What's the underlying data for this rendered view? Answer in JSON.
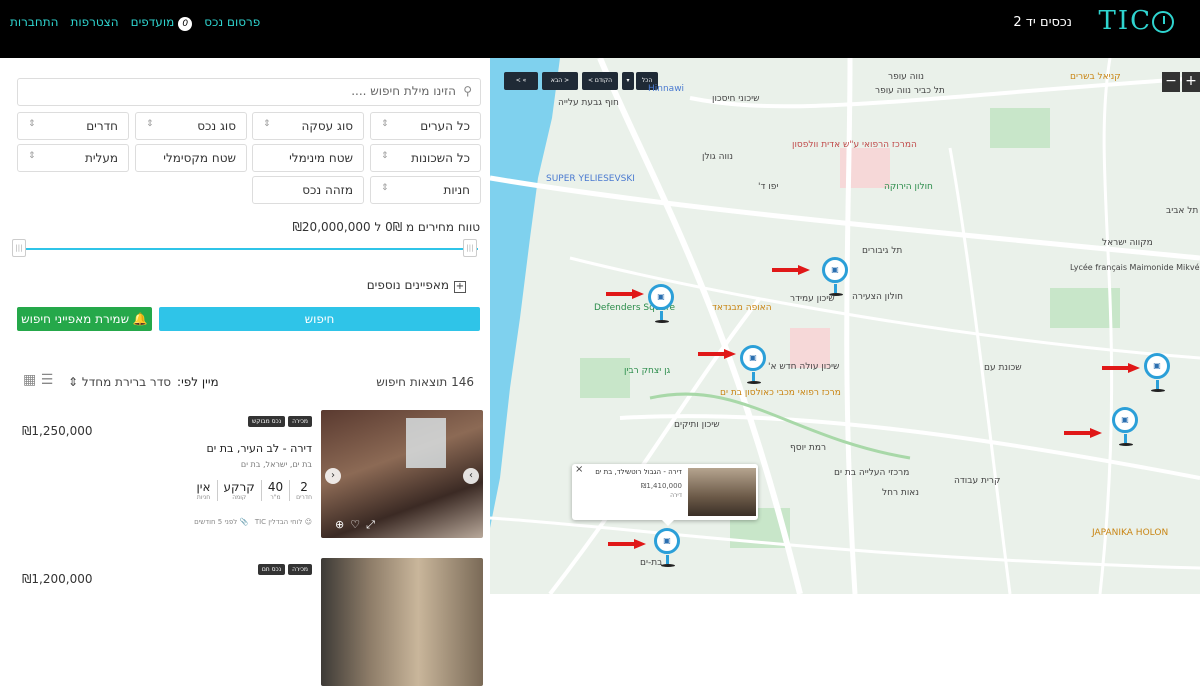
{
  "header": {
    "logo": "TIC",
    "brand_name": "נכסים יד 2",
    "nav": {
      "publish": "פרסום נכס",
      "favorites": "מועדפים",
      "favorites_count": "0",
      "join": "הצטרפות",
      "login": "התחברות"
    }
  },
  "filters": {
    "search_placeholder": "הזינו מילת חיפוש ....",
    "cities": "כל הערים",
    "deal_type": "סוג עסקה",
    "property_type": "סוג נכס",
    "rooms": "חדרים",
    "neighborhoods": "כל השכונות",
    "min_area": "שטח מינימלי",
    "max_area": "שטח מקסימלי",
    "elevator": "מעלית",
    "parking": "חניות",
    "property_id": "מזהה נכס",
    "price_range": "טווח מחירים מ 0₪ ל ₪20,000,000",
    "more_features": "מאפיינים נוספים",
    "search_button": "חיפוש",
    "save_button": "שמירת מאפייני חיפוש"
  },
  "results": {
    "count": "146 תוצאות חיפוש",
    "sort_label": "מיין לפי:",
    "sort_value": "סדר ברירת מחדל",
    "cards": [
      {
        "tags": [
          "מכירה",
          "נכס מבוקש"
        ],
        "price": "₪1,250,000",
        "title": "דירה - לב העיר, בת ים",
        "address": "בת ים, ישראל, בת ים",
        "stats": [
          {
            "value": "2",
            "label": "חדרים"
          },
          {
            "value": "40",
            "label": "מ\"ר"
          },
          {
            "value": "קרקע",
            "label": "קומה"
          },
          {
            "value": "אין",
            "label": "חניות"
          }
        ],
        "agent": "לוחי הבדלין TIC",
        "date": "לפני 5 חודשים"
      },
      {
        "tags": [
          "מכירה",
          "נכס חם"
        ],
        "price": "₪1,200,000"
      }
    ]
  },
  "map": {
    "controls": {
      "prev": "< הקודם",
      "next": "הבא >",
      "all": "הכל",
      "back": "< ",
      "zoom_in": "+",
      "zoom_out": "−"
    },
    "labels": [
      "נווה עופר",
      "תל כביר נווה עופר",
      "קניאל בשרים",
      "שיכוני חיסכון",
      "Hinnawi",
      "חוף גבעת עלייה",
      "המרכז הרפואי ע\"ש אדית וולפסון",
      "נווה גולן",
      "SUPER YELIESEVSKI",
      "יפו ד'",
      "חולון הירוקה",
      "תל גיבורים",
      "שיכון עמידר",
      "חולון הצעירה",
      "Defenders Square",
      "האופה מבגדאד",
      "שיכון עולה חדש א'",
      "גן יצחק רבין",
      "מרכז רפואי מכבי כאולסון בת ים",
      "שיכון ותיקים",
      "רמת יוסף",
      "שכונת עם",
      "קרית עבודה",
      "נאות רחל",
      "בת-ים",
      "JAPANIKA HOLON",
      "Lycée français Maimonide Mikvé Israël",
      "מקווה ישראל",
      "תל אביב",
      "מרכזי העלייה בת ים"
    ],
    "popup": {
      "title": "דירה - הגבול רוטשילד, בת ים",
      "price": "₪1,410,000",
      "kind": "דירה"
    }
  }
}
